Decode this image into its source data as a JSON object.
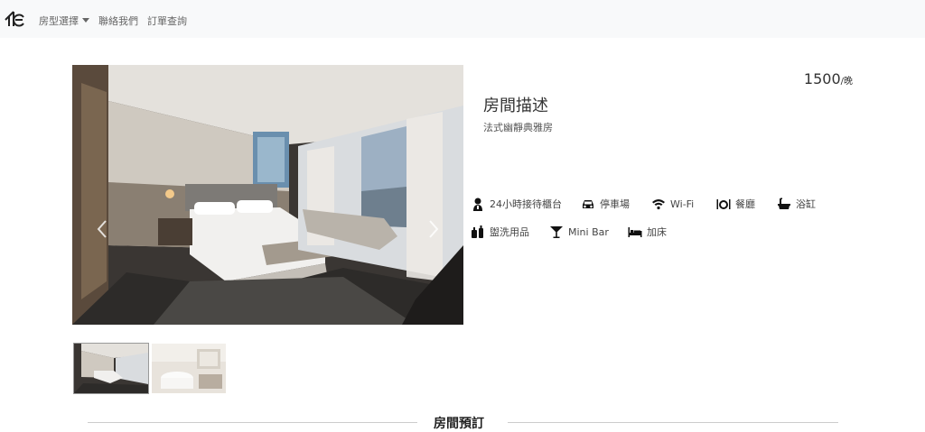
{
  "nav": {
    "logo": "logo-icon",
    "room_types": "房型選擇",
    "contact": "聯絡我們",
    "order_lookup": "訂單查詢"
  },
  "gallery": {
    "thumbnails": [
      "hotel-bedroom-thumbnail",
      "bathroom-thumbnail"
    ],
    "active_index": 0
  },
  "room": {
    "price": "1500",
    "price_unit": "/晚",
    "title": "房間描述",
    "subtitle": "法式幽靜典雅房",
    "amenities": [
      {
        "icon": "concierge-icon",
        "label": "24小時接待櫃台"
      },
      {
        "icon": "car-icon",
        "label": "停車場"
      },
      {
        "icon": "wifi-icon",
        "label": "Wi-Fi"
      },
      {
        "icon": "dining-icon",
        "label": "餐廳"
      },
      {
        "icon": "bathtub-icon",
        "label": "浴缸"
      },
      {
        "icon": "toiletries-icon",
        "label": "盥洗用品"
      },
      {
        "icon": "cocktail-icon",
        "label": "Mini Bar"
      },
      {
        "icon": "bed-icon",
        "label": "加床"
      }
    ]
  },
  "booking": {
    "section_title": "房間預訂"
  }
}
